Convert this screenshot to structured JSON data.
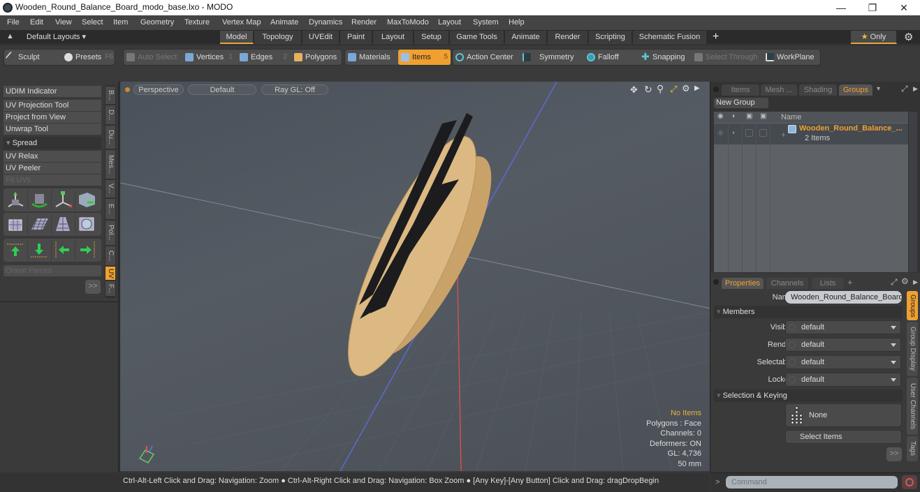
{
  "window": {
    "title": "Wooden_Round_Balance_Board_modo_base.lxo - MODO",
    "controls": [
      "minimize",
      "restore",
      "close"
    ]
  },
  "menu": [
    "File",
    "Edit",
    "View",
    "Select",
    "Item",
    "Geometry",
    "Texture",
    "Vertex Map",
    "Animate",
    "Dynamics",
    "Render",
    "MaxToModo",
    "Layout",
    "System",
    "Help"
  ],
  "layout_bar": {
    "layouts_label": "Default Layouts ▾",
    "tabs": [
      "Model",
      "Topology",
      "UVEdit",
      "Paint",
      "Layout",
      "Setup",
      "Game Tools",
      "Animate",
      "Render",
      "Scripting",
      "Schematic Fusion"
    ],
    "active_tab": "Model",
    "add_label": "+",
    "only_label": "Only"
  },
  "toolbar": {
    "sculpt": "Sculpt",
    "presets": "Presets",
    "presets_key": "F6",
    "auto_select": "Auto Select",
    "vertices": "Vertices",
    "vertices_key": "1",
    "edges": "Edges",
    "edges_key": "2",
    "polygons": "Polygons",
    "materials": "Materials",
    "items": "Items",
    "items_key": "5",
    "action_center": "Action Center",
    "symmetry": "Symmetry",
    "falloff": "Falloff",
    "snapping": "Snapping",
    "select_through": "Select Through",
    "workplane": "WorkPlane"
  },
  "left_panel": {
    "udim": "UDIM Indicator",
    "uv_projection": "UV Projection Tool",
    "project_from_view": "Project from View",
    "unwrap": "Unwrap Tool",
    "spread": "Spread",
    "uv_relax": "UV Relax",
    "uv_peeler": "UV Peeler",
    "fit_uvs": "Fit UVs",
    "orient_pieces": "Orient Pieces",
    "more": ">>",
    "vtabs": [
      "B...",
      "D...",
      "Du...",
      "Mes...",
      "V...",
      "E...",
      "Pol...",
      "C...",
      "UV",
      "F..."
    ],
    "active_vtab": "UV"
  },
  "viewport": {
    "view": "Perspective",
    "shading": "Default",
    "raygl": "Ray GL: Off",
    "info": {
      "items": "No Items",
      "polygons": "Polygons : Face",
      "channels": "Channels: 0",
      "deformers": "Deformers: ON",
      "gl": "GL: 4,736",
      "scale": "50 mm"
    }
  },
  "status_bar": "Ctrl-Alt-Left Click and Drag: Navigation: Zoom ● Ctrl-Alt-Right Click and Drag: Navigation: Box Zoom ● [Any Key]-[Any Button] Click and Drag: dragDropBegin",
  "groups_panel": {
    "tabs": [
      "Items",
      "Mesh ...",
      "Shading",
      "Groups"
    ],
    "active_tab": "Groups",
    "new_group": "New Group",
    "col_name": "Name",
    "rows": [
      {
        "name": "Wooden_Round_Balance_...",
        "sub": "2 Items"
      }
    ]
  },
  "properties_panel": {
    "tabs": [
      "Properties",
      "Channels",
      "Lists"
    ],
    "active_tab": "Properties",
    "add_label": "+",
    "name_label": "Name",
    "name_value": "Wooden_Round_Balance_Board (",
    "members_section": "Members",
    "fields": [
      {
        "label": "Visible",
        "value": "default"
      },
      {
        "label": "Render",
        "value": "default"
      },
      {
        "label": "Selectable",
        "value": "default"
      },
      {
        "label": "Locked",
        "value": "default"
      }
    ],
    "selection_section": "Selection & Keying",
    "none_label": "None",
    "select_items": "Select Items",
    "more": ">>",
    "vtabs": [
      "Groups",
      "Group Display",
      "User Channels",
      "Tags"
    ],
    "active_vtab": "Groups"
  },
  "command": {
    "prompt": ">",
    "placeholder": "Command"
  },
  "colors": {
    "accent": "#f0a030",
    "viewport_bg": "#50565d",
    "wood": "#d8b47c"
  }
}
